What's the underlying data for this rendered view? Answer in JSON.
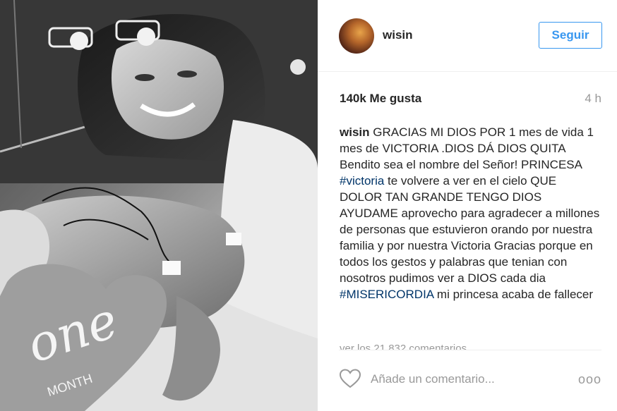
{
  "photo": {
    "heart_card_text": "one",
    "heart_card_subtext": "MONTH"
  },
  "header": {
    "username": "wisin",
    "follow_label": "Seguir"
  },
  "stats": {
    "likes": "140k Me gusta",
    "time_ago": "4 h"
  },
  "caption": {
    "username": "wisin",
    "part1": "GRACIAS MI DIOS POR 1 mes de vida 1 mes de VICTORIA .DIOS DÁ DIOS QUITA Bendito sea el nombre del Señor! PRINCESA ",
    "hashtag1": "#victoria",
    "part2": " te volvere a ver en el cielo QUE DOLOR TAN GRANDE TENGO DIOS AYUDAME aprovecho para agradecer a millones de personas que estuvieron orando por nuestra familia y por nuestra Victoria Gracias porque en todos los gestos y palabras que tenian con nosotros pudimos ver a DIOS cada dia ",
    "hashtag2": "#MISERICORDIA",
    "part3": " mi princesa acaba de fallecer"
  },
  "comments": {
    "view_more": "ver los 21.832 comentarios"
  },
  "footer": {
    "comment_placeholder": "Añade un comentario...",
    "like_icon": "heart-outline-icon",
    "more_icon": "more-options-icon",
    "more_symbol": "ooo"
  },
  "colors": {
    "accent": "#3897f0",
    "hashtag": "#003569",
    "muted": "#999999"
  }
}
